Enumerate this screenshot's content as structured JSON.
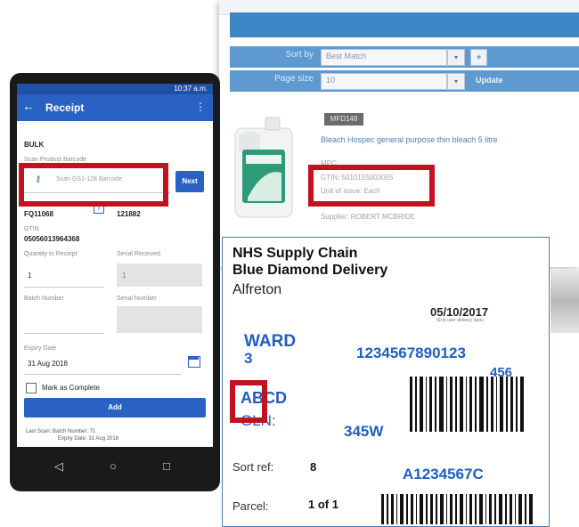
{
  "catalogue": {
    "sort_label": "Sort by",
    "sort_value": "Best Match",
    "page_size_label": "Page size",
    "page_size_value": "10",
    "update_label": "Update",
    "product": {
      "code_badge": "MFD148",
      "title": "Bleach Hospec general purpose thin bleach 5 litre",
      "lines": [
        "MPC: ……",
        "GTIN: 5010155003055",
        "Unit of issue: Each",
        "",
        "Supplier: ROBERT MCBRIDE"
      ]
    }
  },
  "phone": {
    "status_time": "10:37 a.m.",
    "app_title": "Receipt",
    "section": "BULK",
    "scan_label": "Scan Product Barcode",
    "scan_placeholder": "Scan GS1-128 Barcode",
    "scan_button": "Next",
    "code_left": "FQ11068",
    "code_right": "121882",
    "gtin_label": "GTIN",
    "gtin_value": "05056013964368",
    "qty_receipt_label": "Quantity to Receipt",
    "qty_receipt_value": "1",
    "serial_received_label": "Serial Received",
    "serial_received_value": "1",
    "batch_label": "Batch Number",
    "serial_label": "Serial Number",
    "expiry_label": "Expiry Date",
    "expiry_value": "31 Aug 2018",
    "complete_label": "Mark as Complete",
    "add_button": "Add",
    "last_scan_line1": "Last Scan: Batch Number: 71",
    "last_scan_line2": "Expiry Date: 31 Aug 2018"
  },
  "label": {
    "line1": "NHS Supply Chain",
    "line2": "Blue Diamond Delivery",
    "line3": "Alfreton",
    "date": "05/10/2017",
    "date_sub": "(End user delivery date)",
    "ward": "WARD",
    "ward_num": "3",
    "barcode_digits": "1234567890123",
    "barcode_suffix": "456",
    "abcd": "ABCD",
    "gln": "GLN:",
    "code_345w": "345W",
    "sort_label": "Sort ref:",
    "sort_value": "8",
    "order_code": "A1234567C",
    "parcel_label": "Parcel:",
    "parcel_value": "1 of 1"
  },
  "colors": {
    "brand_blue": "#2a62c4",
    "label_blue": "#1f5fc2",
    "highlight_red": "#c4111f"
  }
}
